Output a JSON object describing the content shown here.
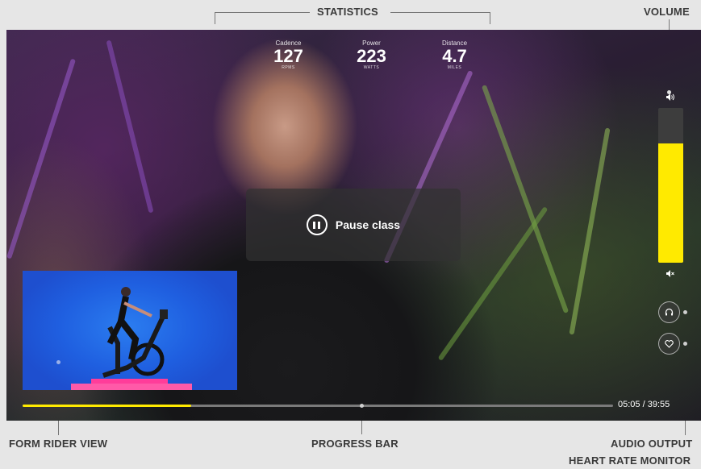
{
  "callouts": {
    "statistics": "STATISTICS",
    "volume": "VOLUME",
    "form_rider_view": "FORM RIDER VIEW",
    "progress_bar": "PROGRESS BAR",
    "audio_output": "AUDIO OUTPUT",
    "heart_rate_monitor": "HEART RATE MONITOR"
  },
  "stats": [
    {
      "label": "Cadence",
      "value": "127",
      "unit": "RPMS"
    },
    {
      "label": "Power",
      "value": "223",
      "unit": "WATTS"
    },
    {
      "label": "Distance",
      "value": "4.7",
      "unit": "MILES"
    }
  ],
  "pause": {
    "label": "Pause class"
  },
  "volume": {
    "level": 0.77,
    "icon_high": "🔉",
    "icon_mute": "🔇"
  },
  "buttons": {
    "audio_output_icon": "headphones-icon",
    "heart_rate_icon": "heart-icon"
  },
  "progress": {
    "fraction": 0.285,
    "elapsed": "05:05",
    "separator": " / ",
    "total": "39:55"
  },
  "colors": {
    "accent": "#ffea00"
  }
}
